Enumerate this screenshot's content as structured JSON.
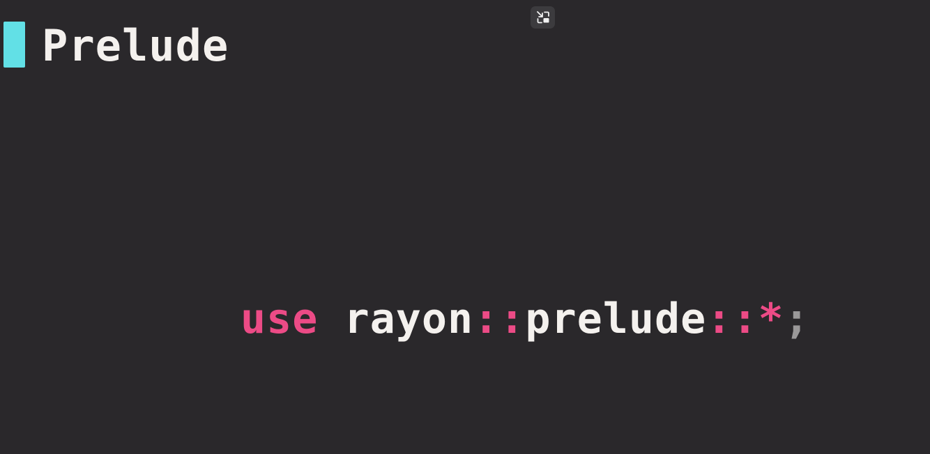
{
  "slide": {
    "title": "Prelude",
    "accent_color": "#62e0e6",
    "background_color": "#2a282b"
  },
  "controls": {
    "pip_icon": "exit-picture-in-picture-icon"
  },
  "code": {
    "tokens": [
      {
        "text": "use",
        "kind": "keyword"
      },
      {
        "text": " ",
        "kind": "space"
      },
      {
        "text": "rayon",
        "kind": "ident"
      },
      {
        "text": "::",
        "kind": "separator"
      },
      {
        "text": "prelude",
        "kind": "ident"
      },
      {
        "text": "::",
        "kind": "separator"
      },
      {
        "text": "*",
        "kind": "separator"
      },
      {
        "text": ";",
        "kind": "punct"
      }
    ],
    "keyword_color": "#ec4b86",
    "ident_color": "#f4f1ee",
    "punct_color": "#9a9899"
  }
}
